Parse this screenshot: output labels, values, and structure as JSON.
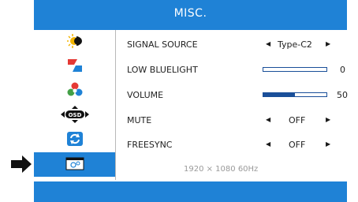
{
  "header": {
    "title": "MISC."
  },
  "sidebar": {
    "items": [
      {
        "icon": "brightness-icon"
      },
      {
        "icon": "image-icon"
      },
      {
        "icon": "color-icon"
      },
      {
        "icon": "osd-icon",
        "label": "OSD"
      },
      {
        "icon": "reset-icon"
      },
      {
        "icon": "misc-icon"
      }
    ],
    "active_index": 5
  },
  "settings": {
    "signal_source": {
      "label": "SIGNAL SOURCE",
      "value": "Type-C2"
    },
    "low_bluelight": {
      "label": "LOW BLUELIGHT",
      "value": "0",
      "level": 0
    },
    "volume": {
      "label": "VOLUME",
      "value": "50",
      "level": 0.5
    },
    "mute": {
      "label": "MUTE",
      "value": "OFF"
    },
    "freesync": {
      "label": "FREESYNC",
      "value": "OFF"
    }
  },
  "status": {
    "resolution": "1920 × 1080  60Hz"
  },
  "colors": {
    "accent": "#1f82d6",
    "bar": "#1a4f99"
  }
}
